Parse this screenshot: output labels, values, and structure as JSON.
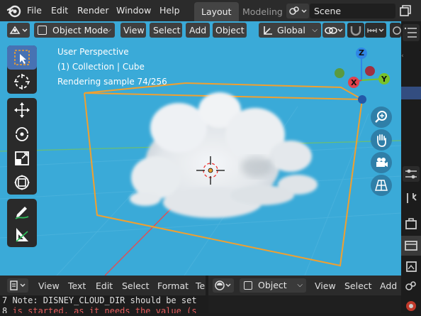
{
  "menubar": {
    "items": [
      "File",
      "Edit",
      "Render",
      "Window",
      "Help"
    ],
    "workspaces": [
      "Layout",
      "Modeling"
    ],
    "active_workspace": "Layout",
    "scene_name": "Scene"
  },
  "viewport_header": {
    "mode": "Object Mode",
    "menus": [
      "View",
      "Select",
      "Add",
      "Object"
    ],
    "transform_orientation": "Global"
  },
  "viewport_overlay": {
    "view_name": "User Perspective",
    "collection_line": "(1) Collection | Cube",
    "render_status": "Rendering sample 74/256"
  },
  "gizmo": {
    "z_label": "Z",
    "y_label": "Y",
    "x_label": "X",
    "colors": {
      "x": "#e0414b",
      "y": "#79c22a",
      "z": "#2f86e6",
      "bg": "#3aaad8",
      "bbox": "#f0a030"
    }
  },
  "text_editor_header": {
    "menus": [
      "View",
      "Text",
      "Edit",
      "Select",
      "Format",
      "Te"
    ]
  },
  "console": {
    "lines": [
      {
        "num": "7",
        "text": " Note: DISNEY_CLOUD_DIR should be set"
      },
      {
        "num": "8",
        "text": " is started, as it needs the value (s"
      }
    ]
  },
  "properties_header": {
    "object_select": "Object",
    "menus": [
      "View",
      "Select",
      "Add"
    ]
  }
}
